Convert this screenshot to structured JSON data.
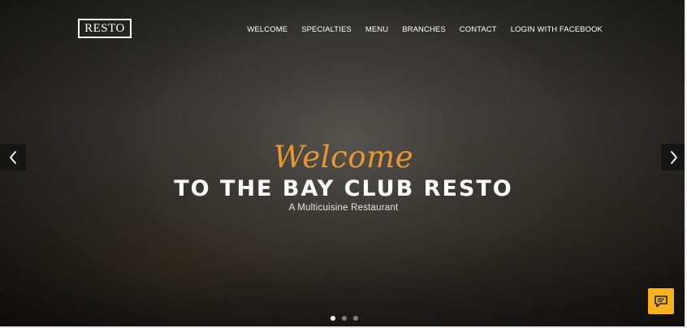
{
  "brand": {
    "logo_text": "RESTO"
  },
  "nav": {
    "items": [
      {
        "label": "WELCOME"
      },
      {
        "label": "SPECIALTIES"
      },
      {
        "label": "MENU"
      },
      {
        "label": "BRANCHES"
      },
      {
        "label": "CONTACT"
      },
      {
        "label": "LOGIN WITH FACEBOOK"
      }
    ]
  },
  "hero": {
    "script_text": "Welcome",
    "headline": "TO THE BAY CLUB RESTO",
    "subline": "A Multicuisine Restaurant",
    "slides_total": 3,
    "active_slide": 1
  },
  "icons": {
    "prev": "chevron-left-icon",
    "next": "chevron-right-icon",
    "chat": "chat-bubble-icon"
  },
  "colors": {
    "accent_script": "#e8962f",
    "chat_button": "#f6b21d",
    "text_primary": "#ffffff"
  }
}
